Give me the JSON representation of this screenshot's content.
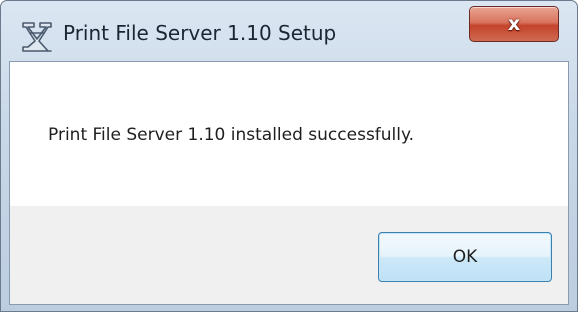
{
  "window": {
    "title": "Print File Server 1.10 Setup",
    "close_glyph": "x",
    "icon": "setup-app-icon"
  },
  "dialog": {
    "message": "Print File Server 1.10 installed successfully.",
    "ok_label": "OK"
  },
  "colors": {
    "close_button": "#c4432b",
    "ok_border": "#3c7fb1",
    "title_bar": "#c9d8e8",
    "footer_bg": "#f0f0f0"
  }
}
